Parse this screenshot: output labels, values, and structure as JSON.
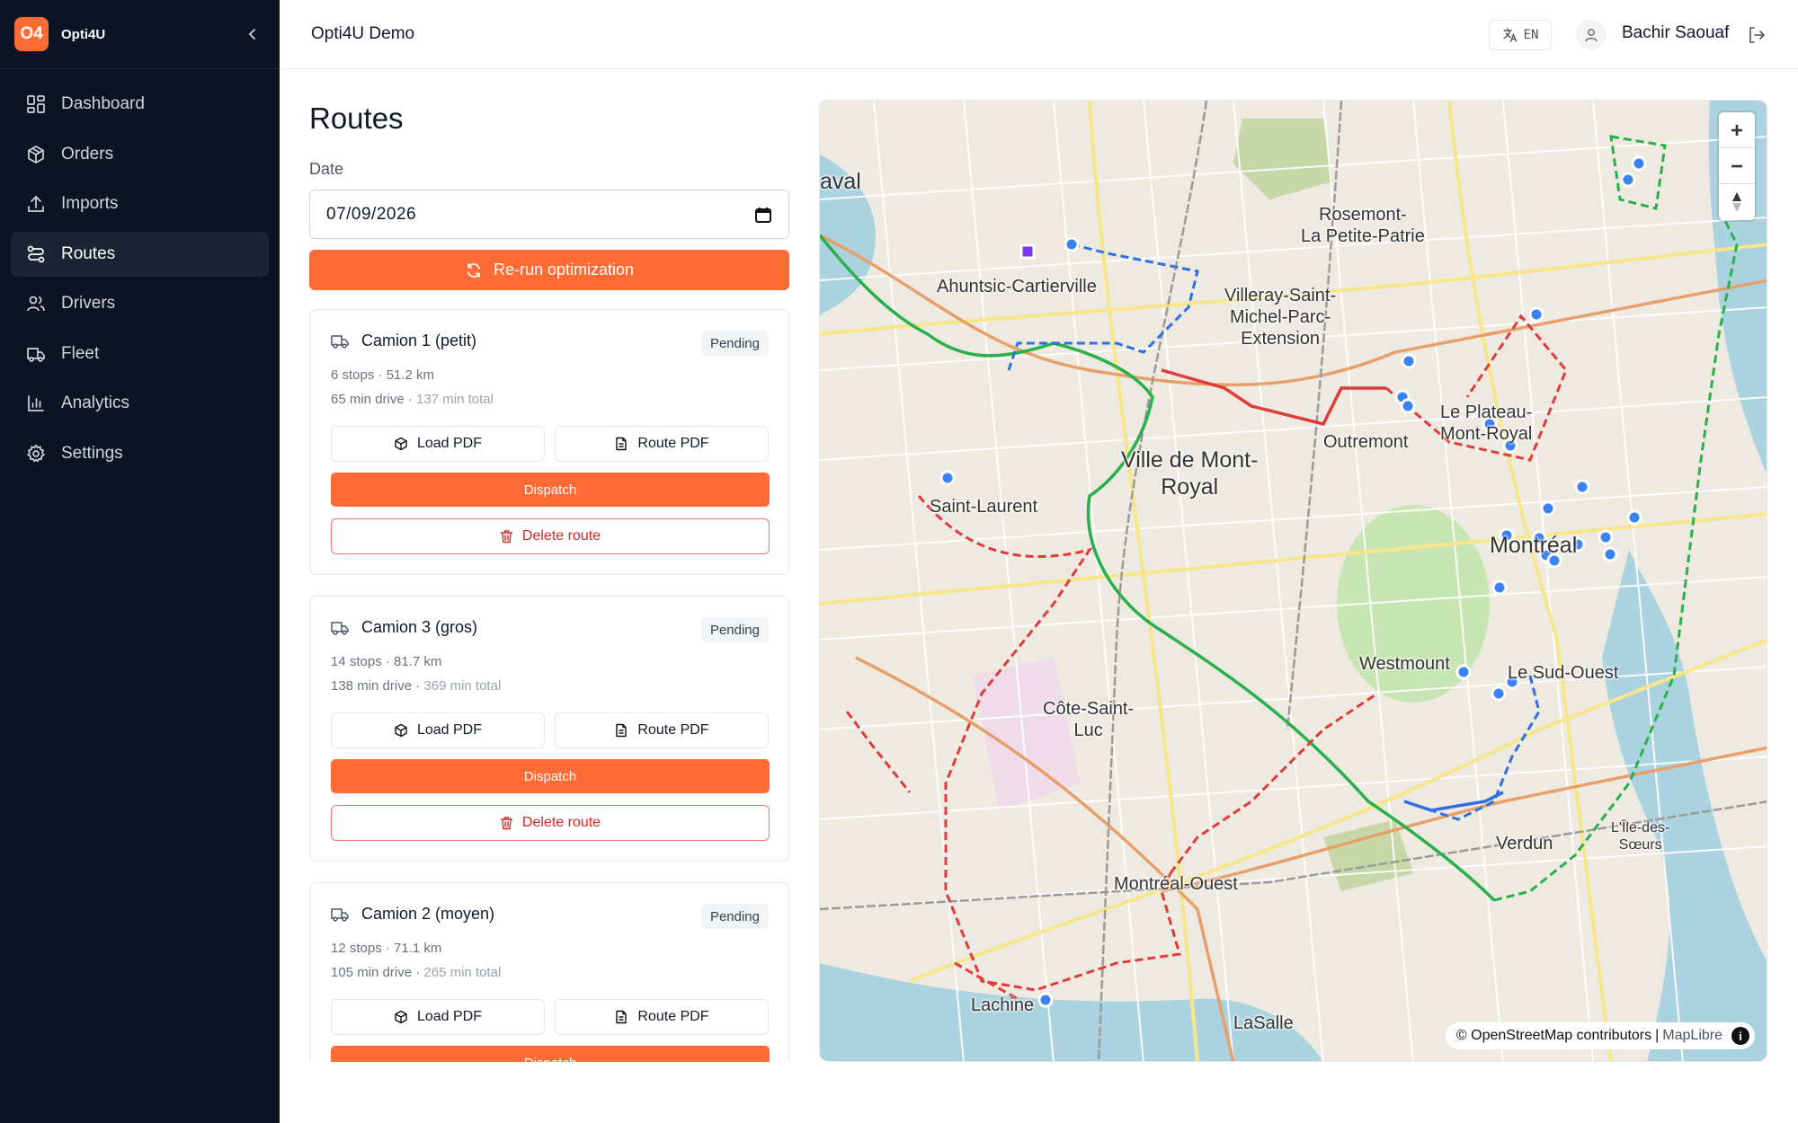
{
  "brand": {
    "logo": "O4",
    "name": "Opti4U"
  },
  "nav": [
    {
      "label": "Dashboard",
      "icon": "dashboard-icon"
    },
    {
      "label": "Orders",
      "icon": "box-icon"
    },
    {
      "label": "Imports",
      "icon": "upload-icon"
    },
    {
      "label": "Routes",
      "icon": "route-icon",
      "active": true
    },
    {
      "label": "Drivers",
      "icon": "users-icon"
    },
    {
      "label": "Fleet",
      "icon": "truck-icon"
    },
    {
      "label": "Analytics",
      "icon": "bar-chart-icon"
    },
    {
      "label": "Settings",
      "icon": "gear-icon"
    }
  ],
  "header": {
    "org": "Opti4U Demo",
    "lang": "EN",
    "user": "Bachir Saouaf"
  },
  "page": {
    "title": "Routes",
    "date_label": "Date",
    "date_value": "07/09/2026",
    "rerun_label": "Re-run optimization"
  },
  "buttons": {
    "load_pdf": "Load PDF",
    "route_pdf": "Route PDF",
    "dispatch": "Dispatch",
    "delete": "Delete route"
  },
  "routes": [
    {
      "name": "Camion 1 (petit)",
      "status": "Pending",
      "stats": "6 stops · 51.2 km",
      "drive": "65 min drive",
      "total": "137 min total"
    },
    {
      "name": "Camion 3 (gros)",
      "status": "Pending",
      "stats": "14 stops · 81.7 km",
      "drive": "138 min drive",
      "total": "369 min total"
    },
    {
      "name": "Camion 2 (moyen)",
      "status": "Pending",
      "stats": "12 stops · 71.1 km",
      "drive": "105 min drive",
      "total": "265 min total"
    }
  ],
  "map": {
    "labels": {
      "rosemont": "Rosemont-\nLa Petite-Patrie",
      "villeray": "Villeray-Saint-\nMichel-Parc-\nExtension",
      "ahuntsic": "Ahuntsic-Cartierville",
      "laval": "aval",
      "plateau": "Le Plateau-\nMont-Royal",
      "outremont": "Outremont",
      "vmr": "Ville de Mont-\nRoyal",
      "saint_laurent": "Saint-Laurent",
      "montreal": "Montréal",
      "westmount": "Westmount",
      "sud_ouest": "Le Sud-Ouest",
      "cote_st_luc": "Côte-Saint-\nLuc",
      "verdun": "Verdun",
      "ile_des_soeurs": "L'Île-des-\nSœurs",
      "montreal_ouest": "Montréal-Ouest",
      "lachine": "Lachine",
      "lasalle": "LaSalle"
    },
    "attribution": "© OpenStreetMap contributors",
    "attribution_lib": "MapLibre",
    "route_colors": {
      "camion_1": "#2f6fe0",
      "camion_2": "#e03b3b",
      "camion_3": "#28b04a"
    }
  }
}
